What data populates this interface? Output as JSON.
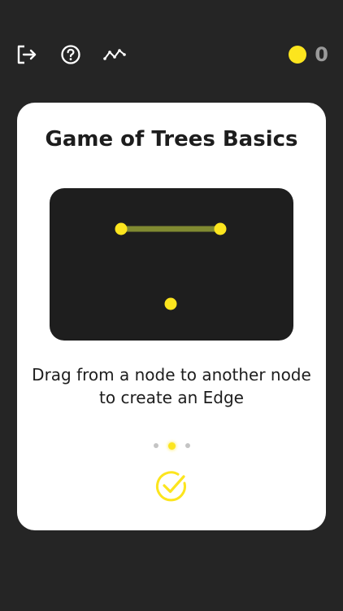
{
  "header": {
    "icons": {
      "exit": "exit-icon",
      "help": "help-icon",
      "stats": "stats-icon",
      "coin": "coin-icon"
    },
    "coin_count": "0"
  },
  "card": {
    "title": "Game of Trees Basics",
    "instruction": "Drag from a node to another node to create an Edge",
    "page_count": 3,
    "current_page": 2,
    "confirm_icon": "check-circle-icon"
  },
  "colors": {
    "background": "#252525",
    "card": "#ffffff",
    "demo_panel": "#1e1e1e",
    "accent": "#fce51e",
    "edge": "#808a31",
    "text": "#1d1d1d",
    "muted": "#9a9a9a"
  }
}
